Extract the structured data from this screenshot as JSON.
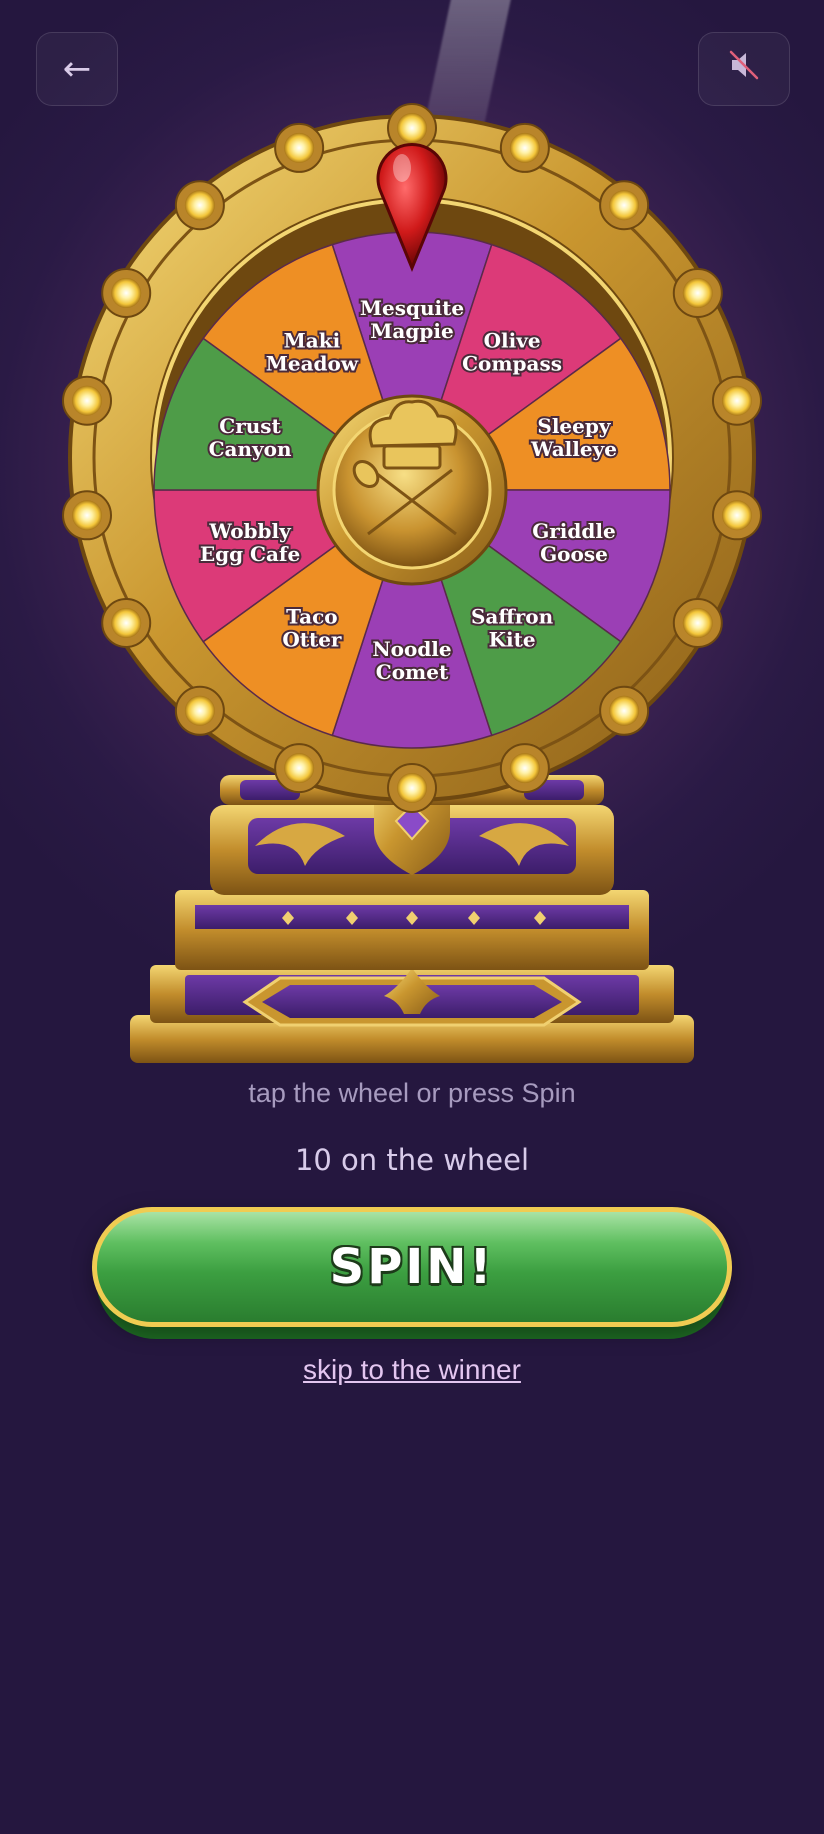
{
  "header": {
    "back_label": "←",
    "back_icon": "arrow-left-icon",
    "mute_icon": "speaker-muted-icon"
  },
  "wheel": {
    "center_icon": "chef-hat-utensils-icon",
    "pointer_icon": "red-pin-pointer-icon",
    "segments": [
      {
        "label": [
          "Mesquite",
          "Magpie"
        ],
        "color": "#9b3fb5"
      },
      {
        "label": [
          "Olive",
          "Compass"
        ],
        "color": "#dc3a78"
      },
      {
        "label": [
          "Sleepy",
          "Walleye"
        ],
        "color": "#ee8f24"
      },
      {
        "label": [
          "Griddle",
          "Goose"
        ],
        "color": "#9b3fb5"
      },
      {
        "label": [
          "Saffron",
          "Kite"
        ],
        "color": "#4e9c48"
      },
      {
        "label": [
          "Noodle",
          "Comet"
        ],
        "color": "#9b3fb5"
      },
      {
        "label": [
          "Taco",
          "Otter"
        ],
        "color": "#ee8f24"
      },
      {
        "label": [
          "Wobbly",
          "Egg Cafe"
        ],
        "color": "#dc3a78"
      },
      {
        "label": [
          "Crust",
          "Canyon"
        ],
        "color": "#4e9c48"
      },
      {
        "label": [
          "Maki",
          "Meadow"
        ],
        "color": "#ee8f24"
      }
    ]
  },
  "instructions": {
    "hint": "tap the wheel or press Spin",
    "count": "10 on the wheel"
  },
  "actions": {
    "spin_label": "SPIN!",
    "skip_label": "skip to the winner"
  }
}
